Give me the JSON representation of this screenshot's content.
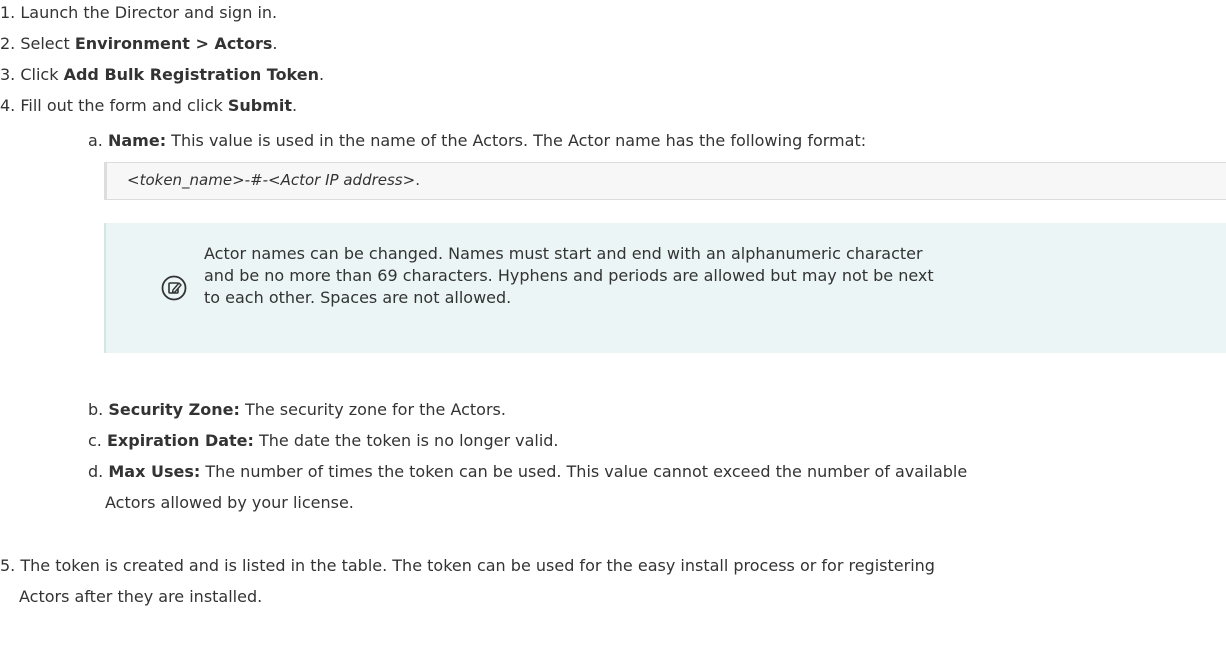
{
  "steps": [
    {
      "num": "1.",
      "pre": "Launch the Director and sign in.",
      "bold": "",
      "post": ""
    },
    {
      "num": "2.",
      "pre": "Select ",
      "bold": "Environment > Actors",
      "post": "."
    },
    {
      "num": "3.",
      "pre": "Click ",
      "bold": "Add Bulk Registration Token",
      "post": "."
    },
    {
      "num": "4.",
      "pre": "Fill out the form and click ",
      "bold": "Submit",
      "post": "."
    }
  ],
  "substeps": {
    "a": {
      "num": "a.",
      "label": "Name:",
      "text": " This value is used in the name of the Actors. The Actor name has the following format:"
    },
    "b": {
      "num": "b.",
      "label": "Security Zone:",
      "text": " The security zone for the Actors."
    },
    "c": {
      "num": "c.",
      "label": "Expiration Date:",
      "text": " The date the token is no longer valid."
    },
    "d": {
      "num": "d.",
      "label": "Max Uses:",
      "text": " The number of times the token can be used. This value cannot exceed the number of available",
      "text2": "Actors allowed by your license."
    }
  },
  "code": {
    "text": "<token_name>-#-<Actor IP address>",
    "suffix": "."
  },
  "note": {
    "icon": "note-edit-icon",
    "lines": [
      "Actor names can be changed. Names must start and end with an alphanumeric character",
      "and be no more than 69 characters. Hyphens and periods are allowed but may not be next",
      "to each other. Spaces are not allowed."
    ]
  },
  "step5": {
    "num": "5.",
    "line1": "The token is created and is listed in the table. The token can be used for the easy install process or for registering",
    "line2": "Actors after they are installed."
  }
}
